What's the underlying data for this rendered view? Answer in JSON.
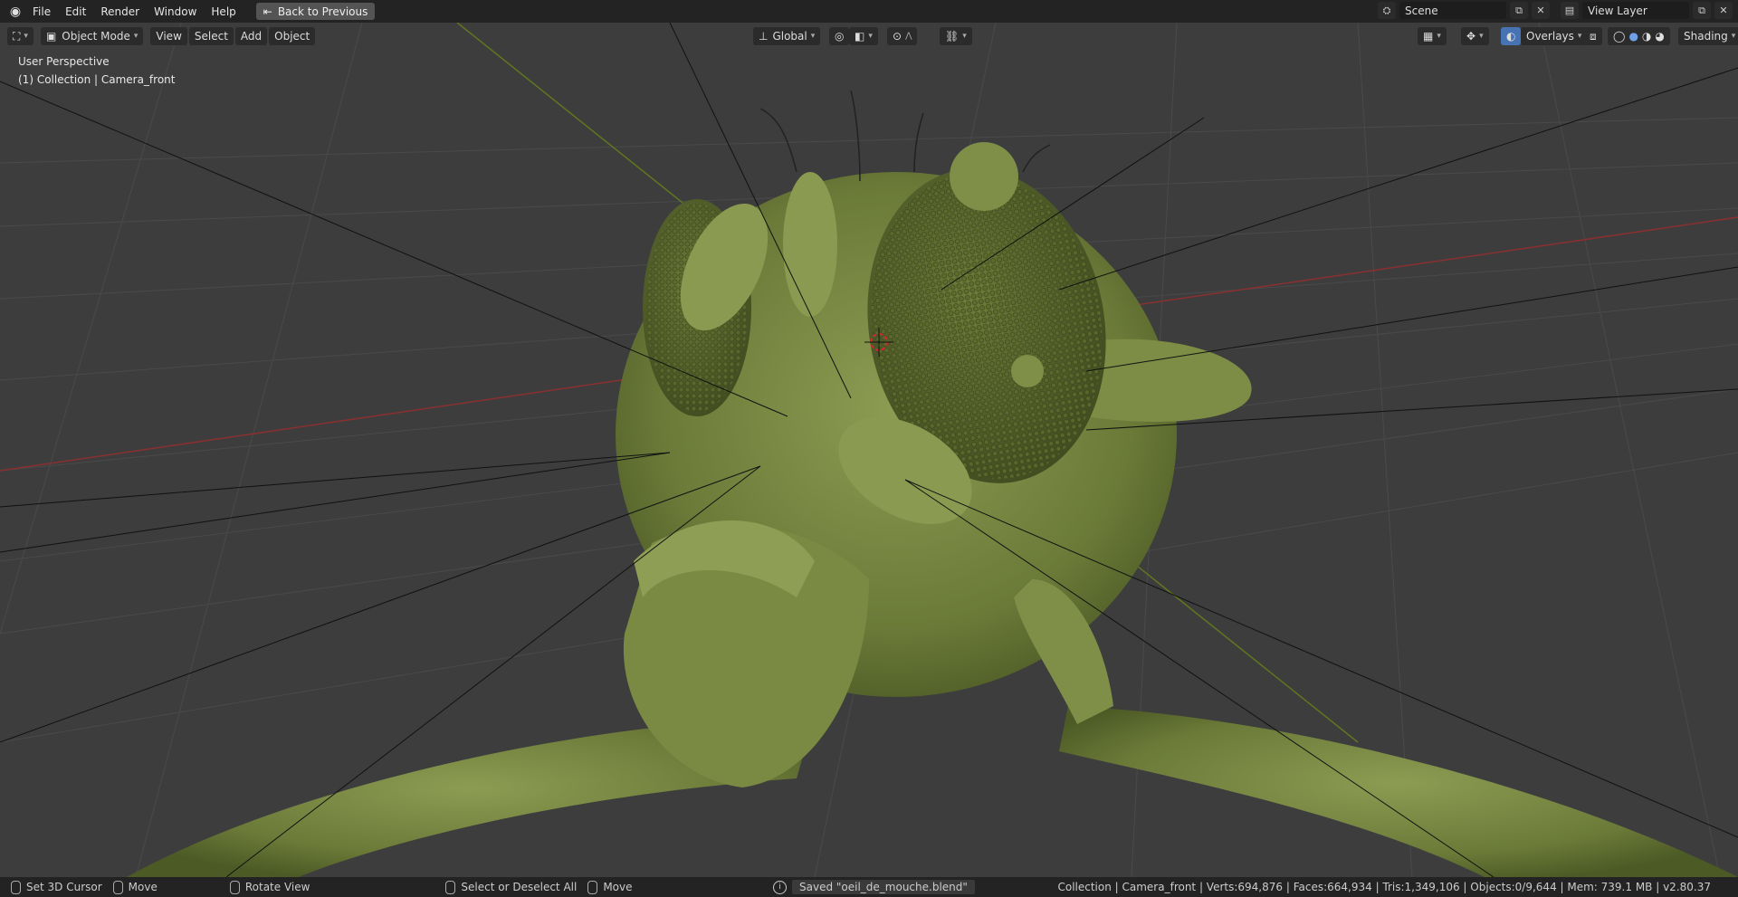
{
  "menu": {
    "items": [
      "File",
      "Edit",
      "Render",
      "Window",
      "Help"
    ],
    "back_label": "Back to Previous"
  },
  "scene": {
    "label": "Scene",
    "view_layer": "View Layer"
  },
  "viewport_header": {
    "mode": "Object Mode",
    "menus": [
      "View",
      "Select",
      "Add",
      "Object"
    ],
    "transform_orientation": "Global",
    "overlays_label": "Overlays",
    "shading_label": "Shading"
  },
  "viewport": {
    "perspective_label": "User Perspective",
    "collection_label": "(1) Collection | Camera_front"
  },
  "status": {
    "hints": [
      "Set 3D Cursor",
      "Move",
      "Rotate View",
      "Select or Deselect All",
      "Move"
    ],
    "saved_message": "Saved \"oeil_de_mouche.blend\"",
    "stats": "Collection | Camera_front | Verts:694,876 | Faces:664,934 | Tris:1,349,106 | Objects:0/9,644 | Mem: 739.1 MB | v2.80.37"
  },
  "colors": {
    "model": "#7a8a45",
    "model_dark": "#4a5a25",
    "x_axis": "#9a3030",
    "y_axis": "#7c9a2a"
  }
}
